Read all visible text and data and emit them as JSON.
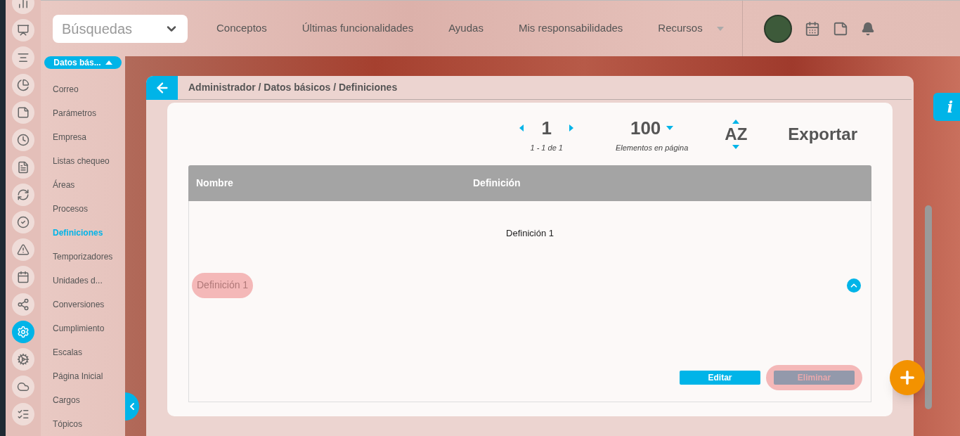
{
  "rail": [
    {
      "kind": "chart",
      "selected": false
    },
    {
      "kind": "presentation",
      "selected": false
    },
    {
      "kind": "timeline",
      "selected": false
    },
    {
      "kind": "pie",
      "selected": false
    },
    {
      "kind": "board",
      "selected": false
    },
    {
      "kind": "clock",
      "selected": false
    },
    {
      "kind": "list",
      "selected": false
    },
    {
      "kind": "cycle",
      "selected": false
    },
    {
      "kind": "check",
      "selected": false
    },
    {
      "kind": "warning",
      "selected": false
    },
    {
      "kind": "calendar",
      "selected": false
    },
    {
      "kind": "network",
      "selected": false
    },
    {
      "kind": "settings",
      "selected": true
    },
    {
      "kind": "cogs",
      "selected": false
    },
    {
      "kind": "cloud",
      "selected": false
    },
    {
      "kind": "checklist",
      "selected": false
    }
  ],
  "search": {
    "value": "Búsquedas"
  },
  "nav": [
    {
      "label": "Conceptos",
      "has_menu": false
    },
    {
      "label": "Últimas funcionalidades",
      "has_menu": false
    },
    {
      "label": "Ayudas",
      "has_menu": false
    },
    {
      "label": "Mis responsabilidades",
      "has_menu": false
    },
    {
      "label": "Recursos",
      "has_menu": true
    }
  ],
  "sidebar": {
    "group": {
      "label": "Datos bás...",
      "expanded": true
    },
    "items": [
      {
        "label": "Correo",
        "selected": false
      },
      {
        "label": "Parámetros",
        "selected": false
      },
      {
        "label": "Empresa",
        "selected": false
      },
      {
        "label": "Listas chequeo",
        "selected": false
      },
      {
        "label": "Áreas",
        "selected": false
      },
      {
        "label": "Procesos",
        "selected": false
      },
      {
        "label": "Definiciones",
        "selected": true
      },
      {
        "label": "Temporizadores",
        "selected": false
      },
      {
        "label": "Unidades d...",
        "selected": false
      },
      {
        "label": "Conversiones",
        "selected": false
      },
      {
        "label": "Cumplimiento",
        "selected": false
      },
      {
        "label": "Escalas",
        "selected": false
      },
      {
        "label": "Página Inicial",
        "selected": false
      },
      {
        "label": "Cargos",
        "selected": false
      },
      {
        "label": "Tópicos",
        "selected": false
      }
    ]
  },
  "breadcrumb": "Administrador / Datos básicos / Definiciones",
  "info_tab": "i",
  "pagination": {
    "page": "1",
    "range": "1 - 1 de 1",
    "per_page": "100",
    "per_page_label": "Elementos en página"
  },
  "sort": "AZ",
  "export": "Exportar",
  "table": {
    "columns": [
      "Nombre",
      "Definición"
    ],
    "rows": [
      {
        "name": "Definición 1",
        "definition": "Definición 1",
        "expanded": true,
        "actions": [
          {
            "label": "Editar",
            "disabled": false
          },
          {
            "label": "Eliminar",
            "disabled": true
          }
        ]
      }
    ]
  }
}
